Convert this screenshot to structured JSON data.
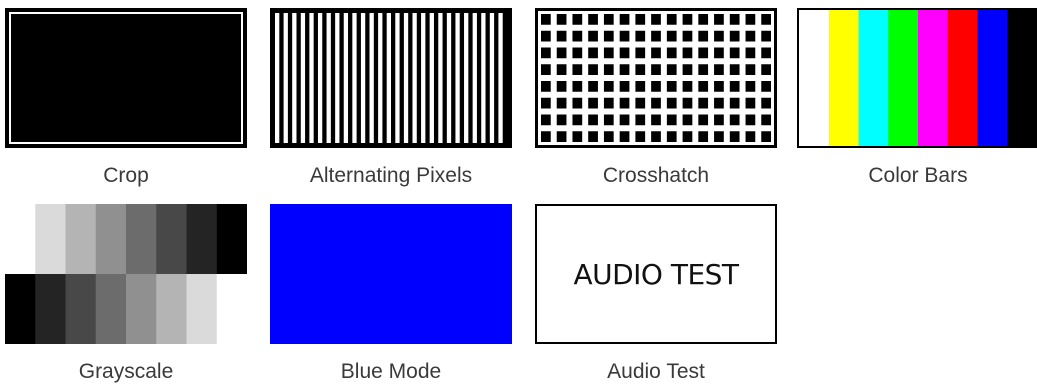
{
  "patterns": [
    {
      "id": "crop",
      "label": "Crop"
    },
    {
      "id": "alternating-pixels",
      "label": "Alternating Pixels"
    },
    {
      "id": "crosshatch",
      "label": "Crosshatch"
    },
    {
      "id": "color-bars",
      "label": "Color Bars",
      "colors": [
        "#ffffff",
        "#ffff00",
        "#00ffff",
        "#00ff00",
        "#ff00ff",
        "#ff0000",
        "#0000ff",
        "#000000"
      ]
    },
    {
      "id": "grayscale",
      "label": "Grayscale",
      "top_colors": [
        "#ffffff",
        "#dadada",
        "#b4b4b4",
        "#909090",
        "#6c6c6c",
        "#484848",
        "#242424",
        "#000000"
      ],
      "bottom_colors": [
        "#000000",
        "#242424",
        "#484848",
        "#6c6c6c",
        "#909090",
        "#b4b4b4",
        "#dadada",
        "#ffffff"
      ]
    },
    {
      "id": "blue-mode",
      "label": "Blue Mode",
      "color": "#0000ff"
    },
    {
      "id": "audio-test",
      "label": "Audio Test",
      "thumb_text": "AUDIO TEST"
    }
  ]
}
